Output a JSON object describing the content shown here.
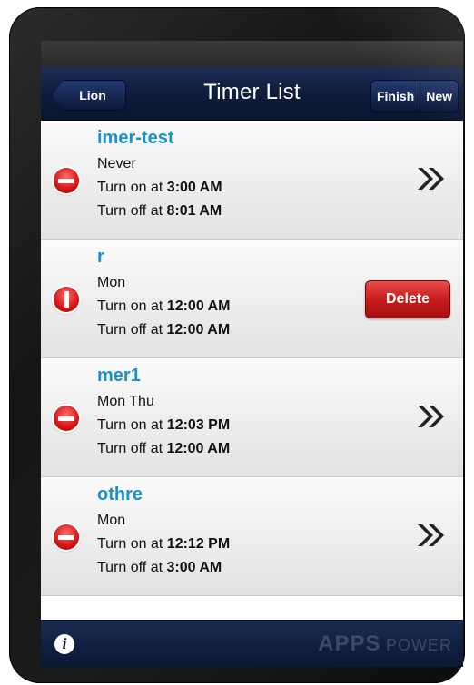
{
  "nav": {
    "back_label": "Lion",
    "title": "Timer List",
    "finish_label": "Finish",
    "new_label": "New"
  },
  "timers": [
    {
      "name": "imer-test",
      "days": "Never",
      "on_prefix": "Turn on at",
      "on_time": "3:00 AM",
      "off_prefix": "Turn off at",
      "off_time": "8:01 AM"
    },
    {
      "name": "r",
      "days": "Mon",
      "on_prefix": "Turn on at",
      "on_time": "12:00 AM",
      "off_prefix": "Turn off at",
      "off_time": "12:00 AM",
      "delete_label": "Delete"
    },
    {
      "name": "mer1",
      "days": "Mon Thu",
      "on_prefix": "Turn on at",
      "on_time": "12:03 PM",
      "off_prefix": "Turn off at",
      "off_time": "12:00 AM"
    },
    {
      "name": "othre",
      "days": "Mon",
      "on_prefix": "Turn on at",
      "on_time": "12:12 PM",
      "off_prefix": "Turn off at",
      "off_time": "3:00 AM"
    }
  ],
  "toolbar": {
    "info_glyph": "i",
    "brand_apps": "APPS",
    "brand_power": "POWER"
  },
  "colors": {
    "accent_blue": "#1b92c6",
    "nav_dark_blue": "#0f1c3c",
    "delete_red": "#c61d1d"
  }
}
